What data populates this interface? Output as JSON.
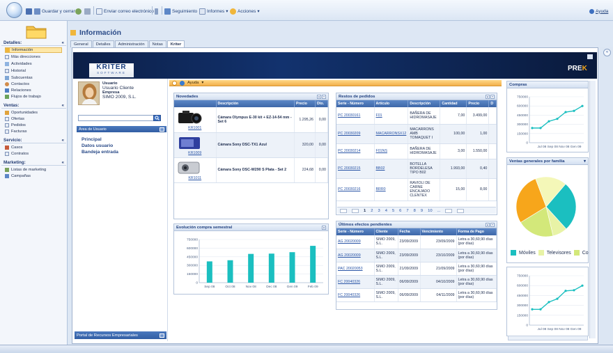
{
  "toolbar": {
    "save_close": "Guardar y cerrar",
    "send_email": "Enviar correo electrónico",
    "tracking": "Seguimiento",
    "reports": "Informes",
    "actions": "Acciones",
    "help": "Ayuda"
  },
  "nav": {
    "details_title": "Detalles:",
    "details": [
      "Información",
      "Más direcciones",
      "Actividades",
      "Historial",
      "Subcuentas",
      "Contactos",
      "Relaciones",
      "Flujos de trabajo"
    ],
    "sales_title": "Ventas:",
    "sales": [
      "Oportunidades",
      "Ofertas",
      "Pedidos",
      "Facturas"
    ],
    "service_title": "Servicio:",
    "service": [
      "Casos",
      "Contratos"
    ],
    "marketing_title": "Marketing:",
    "marketing": [
      "Listas de marketing",
      "Campañas"
    ]
  },
  "header": {
    "title": "Información",
    "tabs": [
      "General",
      "Detalles",
      "Administración",
      "Notas",
      "Kriter"
    ]
  },
  "banner": {
    "brand": "KRITER",
    "brand_sub": "SOFTWARE",
    "right_pre": "PRE",
    "right_accent": "K"
  },
  "user": {
    "label_user": "Usuario",
    "user": "Usuario Cliente",
    "label_company": "Empresa",
    "company": "SIMO 2009, S.L."
  },
  "user_area": {
    "title": "Área de Usuario",
    "links": [
      "Principal",
      "Datos usuario",
      "Bandeja entrada"
    ],
    "portal": "Portal de Recursos Empresariales"
  },
  "helpbar": {
    "label": "Ayuda"
  },
  "novedades": {
    "title": "Novedades",
    "columns": [
      "Descripción",
      "Precio",
      "Dto."
    ],
    "rows": [
      {
        "code": "KR1001",
        "desc": "Cámara Olympus E-30 kit + EZ-14-54 mm -Set 6",
        "price": "1.295,26",
        "disc": "0,00"
      },
      {
        "code": "KR1009",
        "desc": "Cámara Sony DSC-TX1 Azul",
        "price": "320,00",
        "disc": "0,00"
      },
      {
        "code": "KR1011",
        "desc": "Cámara Sony DSC-W290 S Plata - Set 2",
        "price": "224,68",
        "disc": "0,00"
      }
    ]
  },
  "restos": {
    "title": "Restos de pedidos",
    "columns": [
      "Serie - Número",
      "Artículo",
      "Descripción",
      "Cantidad",
      "Precio",
      "D"
    ],
    "rows": [
      [
        "PC 20030161",
        "F01",
        "BAÑERA DE HIDROMASAJE",
        "7,00",
        "3.499,00",
        ""
      ],
      [
        "PC 20030209",
        "MACARRONSX12",
        "MACARRONS AMB TOMAQUET I",
        "100,00",
        "1,00",
        ""
      ],
      [
        "PC 20030214",
        "F01NS",
        "BAÑERA DE HIDROMASAJE",
        "3,00",
        "1.550,00",
        ""
      ],
      [
        "PC 20030215",
        "BB02",
        "BOTELLA BORDELESA TIPO B02",
        "1.993,00",
        "0,40",
        ""
      ],
      [
        "PC 20030216",
        "BRR0",
        "RAVIOLI DE CARNE ENCAJADO CLENTEX",
        "15,00",
        "8,00",
        ""
      ]
    ],
    "pages": [
      "1",
      "2",
      "3",
      "4",
      "5",
      "6",
      "7",
      "8",
      "9",
      "10",
      "..."
    ]
  },
  "efectos": {
    "title": "Últimos efectos pendientes",
    "columns": [
      "Serie - Número",
      "Cliente",
      "Fecha",
      "Vencimiento",
      "Forma de Pago"
    ],
    "rows": [
      [
        "AG 20020009",
        "SIMO 2009, S.L.",
        "23/09/2009",
        "23/09/2009",
        "Letra a 30,60,90 días (por días)"
      ],
      [
        "AG 20020009",
        "SIMO 2009, S.L.",
        "23/09/2009",
        "23/10/2009",
        "Letra a 30,60,90 días (por días)"
      ],
      [
        "PAC 20020053",
        "SIMO 2009, S.L.",
        "21/09/2009",
        "21/09/2009",
        "Letra a 30,60,90 días (por días)"
      ],
      [
        "FC 20040326",
        "SIMO 2009, S.L.",
        "06/09/2009",
        "04/10/2009",
        "Letra a 30,60,90 días (por días)"
      ],
      [
        "FC 20040326",
        "SIMO 2009, S.L.",
        "06/09/2009",
        "04/11/2009",
        "Letra a 30,60,90 días (por días)"
      ]
    ]
  },
  "panels": {
    "compras": "Compras",
    "ventas": "Ventas generales por familia",
    "evolucion": "Evolución compra semestral"
  },
  "chart_data": [
    {
      "type": "bar",
      "title": "Evolución compra semestral",
      "categories": [
        "Sep 08",
        "Oct 08",
        "Nov 08",
        "Dec 08",
        "Gen 09",
        "Feb 09"
      ],
      "values": [
        370000,
        390000,
        500000,
        505000,
        530000,
        640000
      ],
      "yticks": [
        0,
        150000,
        300000,
        450000,
        600000,
        750000
      ],
      "ylim": [
        0,
        750000
      ],
      "color": "#1bbfc0"
    },
    {
      "type": "line",
      "title": "Compras",
      "categories": [
        "Jul 08",
        "",
        "Sep 08",
        "",
        "Nov 08",
        "",
        "Gen 09"
      ],
      "values": [
        240000,
        240000,
        350000,
        390000,
        500000,
        520000,
        600000
      ],
      "yticks": [
        0,
        150000,
        300000,
        450000,
        600000,
        750000
      ],
      "xticks": [
        "Jul 08",
        "Sep 08",
        "Nov 08",
        "Gen 09"
      ],
      "ylim": [
        0,
        750000
      ],
      "color": "#1bbfc0"
    },
    {
      "type": "pie",
      "title": "Ventas generales por familia",
      "legend": [
        "Móviles",
        "Televisores",
        "Co"
      ],
      "slices": [
        {
          "value": 27,
          "color": "#1bbfc0"
        },
        {
          "value": 8,
          "color": "#e8f3a6"
        },
        {
          "value": 20,
          "color": "#d3e87a"
        },
        {
          "value": 28,
          "color": "#f7a61b"
        },
        {
          "value": 17,
          "color": "#f4f7b8"
        }
      ]
    },
    {
      "type": "line",
      "title": "",
      "categories": [
        "Jul 08",
        "",
        "Sep 08",
        "",
        "Nov 08",
        "",
        "Gen 09"
      ],
      "values": [
        240000,
        240000,
        350000,
        400000,
        520000,
        530000,
        600000
      ],
      "yticks": [
        0,
        150000,
        300000,
        450000,
        600000,
        750000
      ],
      "xticks": [
        "Jul 08",
        "Sep 08",
        "Nov 08",
        "Gen 09"
      ],
      "ylim": [
        0,
        750000
      ],
      "color": "#1bbfc0"
    }
  ]
}
